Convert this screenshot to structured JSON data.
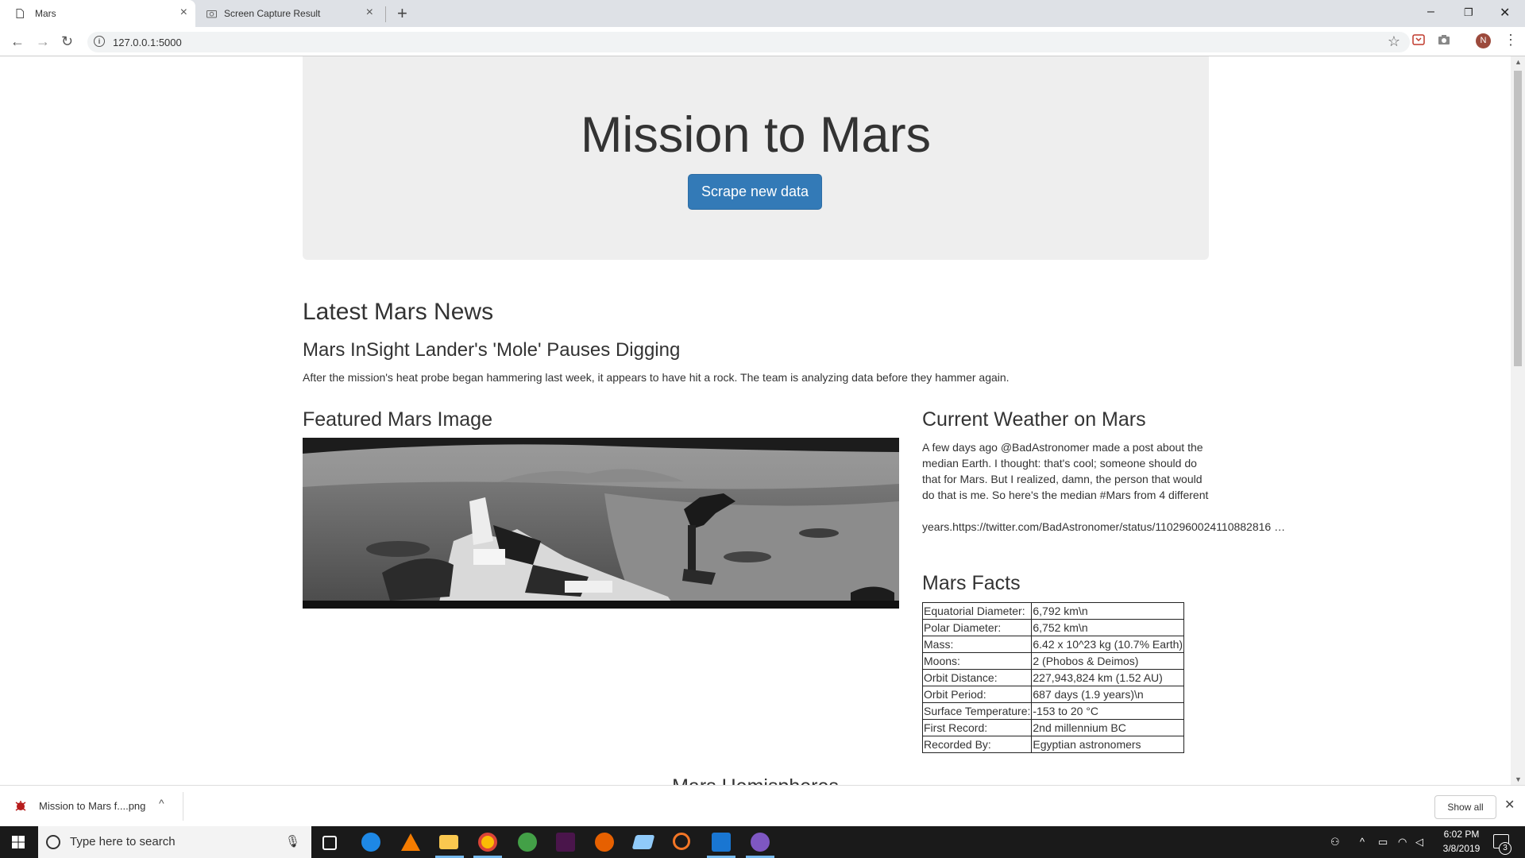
{
  "browser": {
    "tabs": [
      {
        "label": "Mars"
      },
      {
        "label": "Screen Capture Result"
      }
    ],
    "url": "127.0.0.1:5000",
    "profile_initial": "N"
  },
  "page": {
    "jumbotron_title": "Mission to Mars",
    "scrape_button_label": "Scrape new data",
    "news_heading": "Latest Mars News",
    "news_title": "Mars InSight Lander's 'Mole' Pauses Digging",
    "news_paragraph": "After the mission's heat probe began hammering last week, it appears to have hit a rock. The team is analyzing data before they hammer again.",
    "featured_heading": "Featured Mars Image",
    "weather_heading": "Current Weather on Mars",
    "weather_text": "A few days ago @BadAstronomer made a post about the median Earth. I thought: that's cool; someone should do that for Mars. But I realized, damn, the person that would do that is me. So here's the median #Mars from 4 different",
    "weather_text_tail": "years.https://twitter.com/BadAstronomer/status/1102960024110882816 …",
    "facts_heading": "Mars Facts",
    "facts": [
      {
        "label": "Equatorial Diameter:",
        "value": "6,792 km\\n"
      },
      {
        "label": "Polar Diameter:",
        "value": "6,752 km\\n"
      },
      {
        "label": "Mass:",
        "value": "6.42 x 10^23 kg (10.7% Earth)"
      },
      {
        "label": "Moons:",
        "value": "2 (Phobos & Deimos)"
      },
      {
        "label": "Orbit Distance:",
        "value": "227,943,824 km (1.52 AU)"
      },
      {
        "label": "Orbit Period:",
        "value": "687 days (1.9 years)\\n"
      },
      {
        "label": "Surface Temperature:",
        "value": "-153 to 20 °C"
      },
      {
        "label": "First Record:",
        "value": "2nd millennium BC"
      },
      {
        "label": "Recorded By:",
        "value": "Egyptian astronomers"
      }
    ],
    "hemispheres_heading": "Mars Hemispheres"
  },
  "download_shelf": {
    "filename": "Mission to Mars f....png",
    "show_all_label": "Show all"
  },
  "taskbar": {
    "search_placeholder": "Type here to search",
    "time": "6:02 PM",
    "date": "3/8/2019",
    "notification_count": "3"
  },
  "colors": {
    "accent_button": "#337ab7",
    "jumbotron_bg": "#eeeeee",
    "taskbar_bg": "#1a1a1a"
  }
}
